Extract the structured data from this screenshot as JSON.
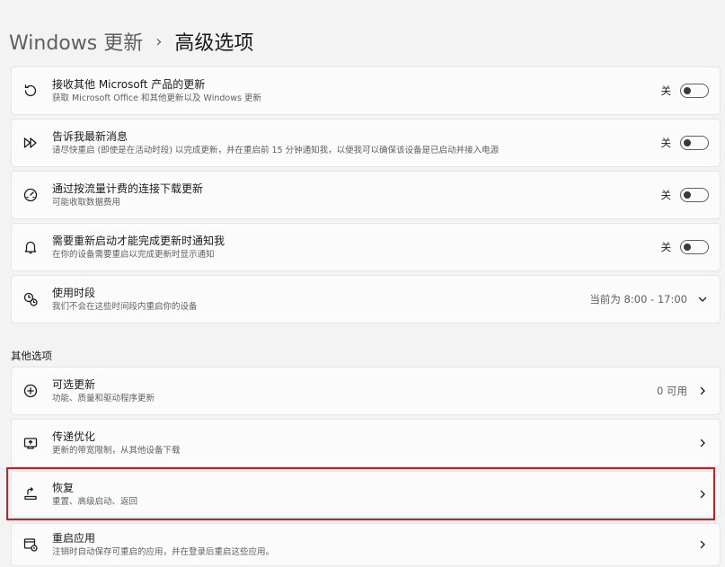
{
  "breadcrumb": {
    "parent": "Windows 更新",
    "separator": "›",
    "current": "高级选项"
  },
  "settings": {
    "other_products": {
      "title": "接收其他 Microsoft 产品的更新",
      "desc": "获取 Microsoft Office 和其他更新以及 Windows 更新",
      "state_label": "关",
      "icon": "history-icon",
      "on": false
    },
    "notify_me": {
      "title": "告诉我最新消息",
      "desc": "请尽快重启 (即使是在活动时段) 以完成更新，并在重启前 15 分钟通知我，以便我可以确保该设备是已启动并接入电源",
      "state_label": "关",
      "icon": "fast-forward-icon",
      "on": false
    },
    "metered": {
      "title": "通过按流量计费的连接下载更新",
      "desc": "可能收取数据费用",
      "state_label": "关",
      "icon": "gauge-icon",
      "on": false
    },
    "restart_notify": {
      "title": "需要重新启动才能完成更新时通知我",
      "desc": "在你的设备需要重启以完成更新时显示通知",
      "state_label": "关",
      "icon": "bell-icon",
      "on": false
    },
    "active_hours": {
      "title": "使用时段",
      "desc": "我们不会在这些时间段内重启你的设备",
      "value": "当前为 8:00 - 17:00",
      "icon": "clock-settings-icon"
    }
  },
  "other_options": {
    "heading": "其他选项",
    "optional_updates": {
      "title": "可选更新",
      "desc": "功能、质量和驱动程序更新",
      "value": "0 可用",
      "icon": "plus-circle-icon"
    },
    "delivery_optimization": {
      "title": "传递优化",
      "desc": "更新的带宽限制，从其他设备下载",
      "icon": "delivery-icon"
    },
    "recovery": {
      "title": "恢复",
      "desc": "重置、高级启动、返回",
      "icon": "recovery-icon"
    },
    "restart_apps": {
      "title": "重启应用",
      "desc": "注销时自动保存可重启的应用，并在登录后重启这些应用。",
      "icon": "restart-apps-icon"
    }
  },
  "colors": {
    "highlight": "#e0141e",
    "background": "#f3f3f3",
    "card": "#fbfbfb"
  }
}
